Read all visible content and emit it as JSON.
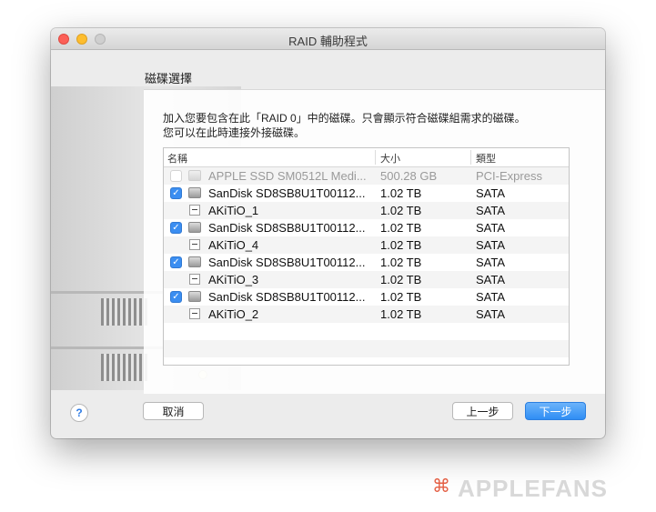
{
  "window": {
    "title": "RAID 輔助程式"
  },
  "section_title": "磁碟選擇",
  "description": {
    "line1": "加入您要包含在此「RAID 0」中的磁碟。只會顯示符合磁碟組需求的磁碟。",
    "line2": "您可以在此時連接外接磁碟。"
  },
  "table": {
    "headers": {
      "name": "名稱",
      "size": "大小",
      "type": "類型"
    },
    "rows": [
      {
        "kind": "disk",
        "checked": false,
        "disabled": true,
        "name": "APPLE SSD SM0512L Medi...",
        "size": "500.28 GB",
        "type": "PCI-Express"
      },
      {
        "kind": "disk",
        "checked": true,
        "disabled": false,
        "name": "SanDisk SD8SB8U1T00112...",
        "size": "1.02 TB",
        "type": "SATA"
      },
      {
        "kind": "volume",
        "name": "AKiTiO_1",
        "size": "1.02 TB",
        "type": "SATA"
      },
      {
        "kind": "disk",
        "checked": true,
        "disabled": false,
        "name": "SanDisk SD8SB8U1T00112...",
        "size": "1.02 TB",
        "type": "SATA"
      },
      {
        "kind": "volume",
        "name": "AKiTiO_4",
        "size": "1.02 TB",
        "type": "SATA"
      },
      {
        "kind": "disk",
        "checked": true,
        "disabled": false,
        "name": "SanDisk SD8SB8U1T00112...",
        "size": "1.02 TB",
        "type": "SATA"
      },
      {
        "kind": "volume",
        "name": "AKiTiO_3",
        "size": "1.02 TB",
        "type": "SATA"
      },
      {
        "kind": "disk",
        "checked": true,
        "disabled": false,
        "name": "SanDisk SD8SB8U1T00112...",
        "size": "1.02 TB",
        "type": "SATA"
      },
      {
        "kind": "volume",
        "name": "AKiTiO_2",
        "size": "1.02 TB",
        "type": "SATA"
      }
    ]
  },
  "buttons": {
    "help": "?",
    "cancel": "取消",
    "back": "上一步",
    "next": "下一步"
  },
  "watermark": {
    "icon": "⌘",
    "text": "APPLEFANS"
  },
  "colors": {
    "accent": "#3b8ef1",
    "close": "#fc5f57",
    "minimize": "#fdbd2e"
  }
}
